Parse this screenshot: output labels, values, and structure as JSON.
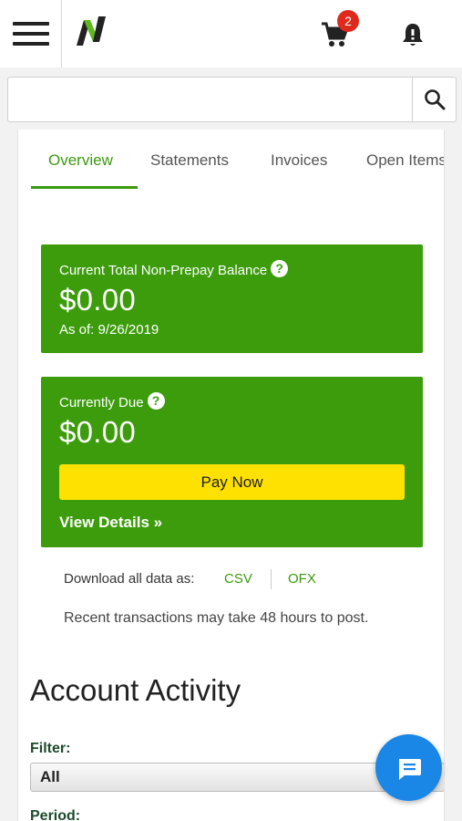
{
  "header": {
    "cart_count": "2",
    "icons": [
      "hamburger-menu-icon",
      "brand-logo",
      "cart-icon",
      "bell-icon"
    ]
  },
  "search": {
    "value": "",
    "placeholder": ""
  },
  "tabs": [
    {
      "label": "Overview",
      "active": true
    },
    {
      "label": "Statements",
      "active": false
    },
    {
      "label": "Invoices",
      "active": false
    },
    {
      "label": "Open Items",
      "active": false
    }
  ],
  "balance_card": {
    "label": "Current Total Non-Prepay Balance",
    "amount": "$0.00",
    "as_of": "As of: 9/26/2019"
  },
  "due_card": {
    "label": "Currently Due",
    "amount": "$0.00",
    "pay_button": "Pay Now",
    "view_details": "View Details »"
  },
  "download": {
    "label": "Download all data as:",
    "csv": "CSV",
    "ofx": "OFX",
    "note": "Recent transactions may take 48 hours to post."
  },
  "activity": {
    "title": "Account Activity",
    "filter_label": "Filter:",
    "filter_value": "All",
    "period_label": "Period:"
  },
  "colors": {
    "accent_green": "#3c9c0b",
    "pay_yellow": "#ffe100",
    "chat_blue": "#1a86e6",
    "badge_red": "#e0291d"
  }
}
